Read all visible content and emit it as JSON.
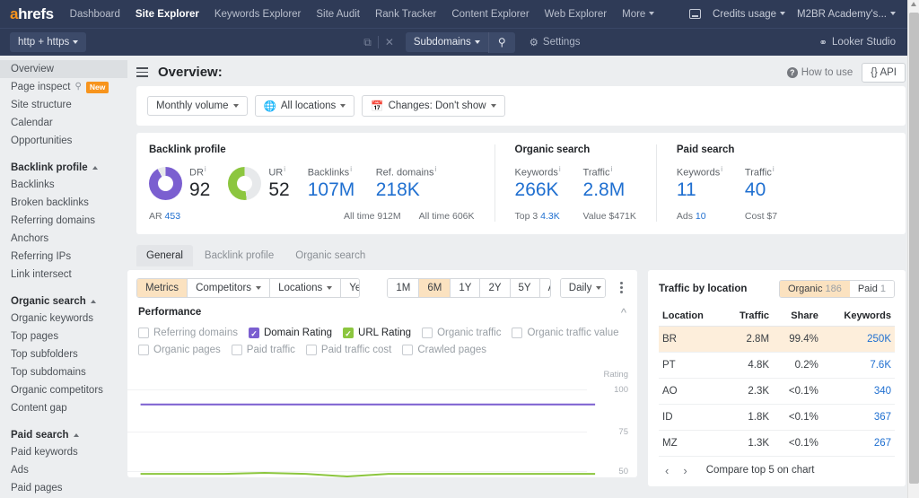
{
  "topnav": {
    "logo": "ahrefs",
    "links": [
      {
        "label": "Dashboard",
        "active": false
      },
      {
        "label": "Site Explorer",
        "active": true
      },
      {
        "label": "Keywords Explorer",
        "active": false
      },
      {
        "label": "Site Audit",
        "active": false
      },
      {
        "label": "Rank Tracker",
        "active": false
      },
      {
        "label": "Content Explorer",
        "active": false
      },
      {
        "label": "Web Explorer",
        "active": false
      },
      {
        "label": "More",
        "active": false
      }
    ],
    "credits_label": "Credits usage",
    "account_label": "M2BR Academy's..."
  },
  "searchbar": {
    "protocol": "http + https",
    "query": "",
    "placeholder": "",
    "mode": "Subdomains",
    "search_icon": "search-icon",
    "settings_label": "Settings",
    "looker_label": "Looker Studio"
  },
  "sidebar": {
    "items": [
      {
        "label": "Overview",
        "active": true,
        "type": "item"
      },
      {
        "label": "Page inspect",
        "active": false,
        "type": "item",
        "icon": "search-icon",
        "badge": "New"
      },
      {
        "label": "Site structure",
        "active": false,
        "type": "item"
      },
      {
        "label": "Calendar",
        "active": false,
        "type": "item"
      },
      {
        "label": "Opportunities",
        "active": false,
        "type": "item"
      },
      {
        "label": "Backlink profile",
        "type": "group"
      },
      {
        "label": "Backlinks",
        "active": false,
        "type": "item"
      },
      {
        "label": "Broken backlinks",
        "active": false,
        "type": "item"
      },
      {
        "label": "Referring domains",
        "active": false,
        "type": "item"
      },
      {
        "label": "Anchors",
        "active": false,
        "type": "item"
      },
      {
        "label": "Referring IPs",
        "active": false,
        "type": "item"
      },
      {
        "label": "Link intersect",
        "active": false,
        "type": "item"
      },
      {
        "label": "Organic search",
        "type": "group"
      },
      {
        "label": "Organic keywords",
        "active": false,
        "type": "item"
      },
      {
        "label": "Top pages",
        "active": false,
        "type": "item"
      },
      {
        "label": "Top subfolders",
        "active": false,
        "type": "item"
      },
      {
        "label": "Top subdomains",
        "active": false,
        "type": "item"
      },
      {
        "label": "Organic competitors",
        "active": false,
        "type": "item"
      },
      {
        "label": "Content gap",
        "active": false,
        "type": "item"
      },
      {
        "label": "Paid search",
        "type": "group"
      },
      {
        "label": "Paid keywords",
        "active": false,
        "type": "item"
      },
      {
        "label": "Ads",
        "active": false,
        "type": "item"
      },
      {
        "label": "Paid pages",
        "active": false,
        "type": "item"
      }
    ]
  },
  "page": {
    "title": "Overview:",
    "how_to_use": "How to use",
    "api_label": "{} API"
  },
  "filters": [
    {
      "label": "Monthly volume",
      "icon": null
    },
    {
      "label": "All locations",
      "icon": "globe-icon"
    },
    {
      "label": "Changes: Don't show",
      "icon": "calendar-icon"
    }
  ],
  "metrics": {
    "groups": [
      {
        "title": "Backlink profile",
        "items": [
          {
            "kind": "donut",
            "label": "DR",
            "value": "92",
            "sub_label": "AR",
            "sub_value": "453",
            "percent": 92,
            "color": "#7b5fd0"
          },
          {
            "kind": "donut",
            "label": "UR",
            "value": "52",
            "percent": 52,
            "color": "#8cc63f"
          },
          {
            "kind": "stat",
            "label": "Backlinks",
            "value": "107M",
            "sub_label": "All time",
            "sub_value": "912M"
          },
          {
            "kind": "stat",
            "label": "Ref. domains",
            "value": "218K",
            "sub_label": "All time",
            "sub_value": "606K"
          }
        ]
      },
      {
        "title": "Organic search",
        "items": [
          {
            "kind": "stat",
            "label": "Keywords",
            "value": "266K",
            "sub_label": "Top 3",
            "sub_value": "4.3K"
          },
          {
            "kind": "stat",
            "label": "Traffic",
            "value": "2.8M",
            "sub_label": "Value",
            "sub_value": "$471K"
          }
        ]
      },
      {
        "title": "Paid search",
        "items": [
          {
            "kind": "stat",
            "label": "Keywords",
            "value": "11",
            "sub_label": "Ads",
            "sub_value": "10"
          },
          {
            "kind": "stat",
            "label": "Traffic",
            "value": "40",
            "sub_label": "Cost",
            "sub_value": "$7"
          }
        ]
      }
    ]
  },
  "tabs": [
    {
      "label": "General",
      "active": true
    },
    {
      "label": "Backlink profile",
      "active": false
    },
    {
      "label": "Organic search",
      "active": false
    }
  ],
  "toolbar": {
    "left": [
      {
        "label": "Metrics",
        "selected": true,
        "caret": false
      },
      {
        "label": "Competitors",
        "selected": false,
        "caret": true
      },
      {
        "label": "Locations",
        "selected": false,
        "caret": true
      },
      {
        "label": "Years",
        "selected": false,
        "caret": false
      }
    ],
    "ranges": [
      {
        "label": "1M",
        "selected": false
      },
      {
        "label": "6M",
        "selected": true
      },
      {
        "label": "1Y",
        "selected": false
      },
      {
        "label": "2Y",
        "selected": false
      },
      {
        "label": "5Y",
        "selected": false
      },
      {
        "label": "All",
        "selected": false
      }
    ],
    "granularity": "Daily"
  },
  "performance": {
    "title": "Performance",
    "checkboxes": [
      {
        "label": "Referring domains",
        "checked": false,
        "color": "#c7cbd0"
      },
      {
        "label": "Domain Rating",
        "checked": true,
        "color": "#7b5fd0"
      },
      {
        "label": "URL Rating",
        "checked": true,
        "color": "#8cc63f"
      },
      {
        "label": "Organic traffic",
        "checked": false,
        "color": "#c7cbd0"
      },
      {
        "label": "Organic traffic value",
        "checked": false,
        "color": "#c7cbd0"
      },
      {
        "label": "Organic pages",
        "checked": false,
        "color": "#c7cbd0"
      },
      {
        "label": "Paid traffic",
        "checked": false,
        "color": "#c7cbd0"
      },
      {
        "label": "Paid traffic cost",
        "checked": false,
        "color": "#c7cbd0"
      },
      {
        "label": "Crawled pages",
        "checked": false,
        "color": "#c7cbd0"
      }
    ]
  },
  "chart_data": {
    "type": "line",
    "title": "Performance",
    "ylabel": "Rating",
    "xlabel": "",
    "ylim": [
      50,
      112
    ],
    "yticks": [
      100,
      75,
      50
    ],
    "grid": true,
    "legend": "checkbox-row",
    "series": [
      {
        "name": "Domain Rating",
        "color": "#7b5fd0",
        "values": [
          92,
          92,
          92,
          92,
          92,
          92,
          92,
          92,
          92,
          92,
          92,
          92
        ]
      },
      {
        "name": "URL Rating",
        "color": "#8cc63f",
        "values": [
          52,
          52,
          52,
          52.6,
          52,
          50.5,
          52,
          52,
          52,
          52,
          52,
          52
        ]
      }
    ]
  },
  "traffic_by_location": {
    "title": "Traffic by location",
    "toggle": [
      {
        "label": "Organic",
        "count": "186",
        "selected": true
      },
      {
        "label": "Paid",
        "count": "1",
        "selected": false
      }
    ],
    "columns": [
      "Location",
      "Traffic",
      "Share",
      "Keywords"
    ],
    "rows": [
      {
        "location": "BR",
        "traffic": "2.8M",
        "share": "99.4%",
        "keywords": "250K",
        "highlight": true
      },
      {
        "location": "PT",
        "traffic": "4.8K",
        "share": "0.2%",
        "keywords": "7.6K",
        "highlight": false
      },
      {
        "location": "AO",
        "traffic": "2.3K",
        "share": "<0.1%",
        "keywords": "340",
        "highlight": false
      },
      {
        "location": "ID",
        "traffic": "1.8K",
        "share": "<0.1%",
        "keywords": "367",
        "highlight": false
      },
      {
        "location": "MZ",
        "traffic": "1.3K",
        "share": "<0.1%",
        "keywords": "267",
        "highlight": false
      }
    ],
    "footer": "Compare top 5 on chart"
  },
  "colors": {
    "navy": "#2f3b57",
    "accent_orange": "#f7941d",
    "link_blue": "#1f6fd0",
    "purple": "#7b5fd0",
    "green": "#8cc63f",
    "highlight": "#fdeedb"
  }
}
